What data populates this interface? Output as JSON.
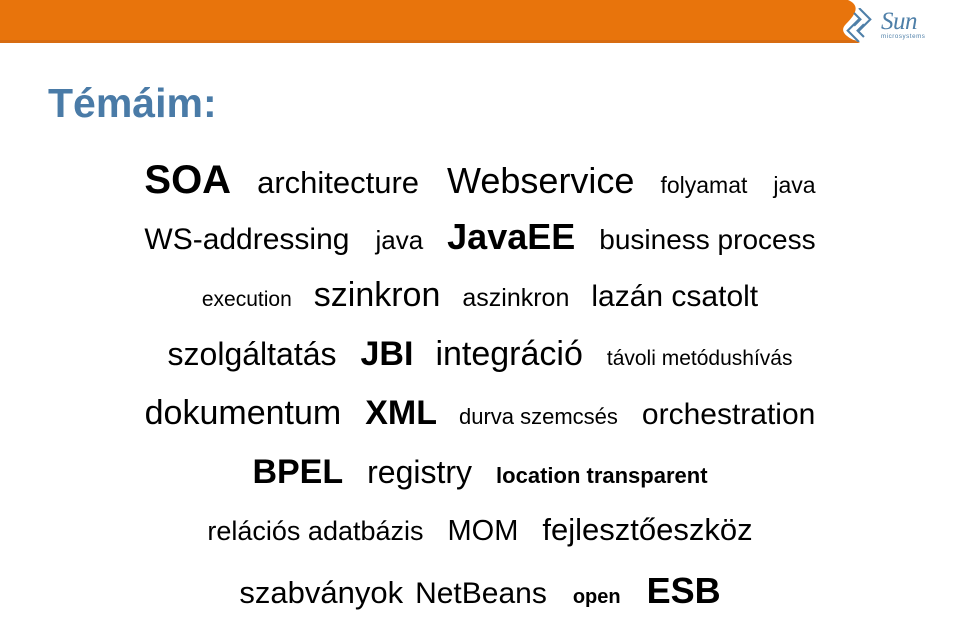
{
  "header": {
    "band_color": "#e8740c",
    "band_edge_color": "#d16a14",
    "logo": {
      "mark_name": "sun-diamond-logo-icon",
      "wordmark": "Sun",
      "tagline": "microsystems",
      "color": "#4e7fa8"
    }
  },
  "slide": {
    "title": "Témáim:",
    "title_color": "#4a7ba7",
    "background": "#ffffff"
  },
  "word_cloud": {
    "text_color": "#000000",
    "rows": [
      {
        "words": [
          {
            "text": "SOA",
            "size": 40,
            "weight": "bold",
            "gap_after": 26
          },
          {
            "text": "architecture",
            "size": 31,
            "weight": "normal",
            "gap_after": 28
          },
          {
            "text": "Webservice",
            "size": 36,
            "weight": "normal",
            "gap_after": 26
          },
          {
            "text": "folyamat",
            "size": 23,
            "weight": "normal",
            "gap_after": 26
          },
          {
            "text": "java",
            "size": 23,
            "weight": "normal",
            "gap_after": 0
          }
        ]
      },
      {
        "words": [
          {
            "text": "WS-addressing",
            "size": 30,
            "weight": "normal",
            "gap_after": 26
          },
          {
            "text": "java",
            "size": 26,
            "weight": "normal",
            "gap_after": 24
          },
          {
            "text": "JavaEE",
            "size": 36,
            "weight": "bold",
            "gap_after": 24
          },
          {
            "text": "business process",
            "size": 28,
            "weight": "normal",
            "gap_after": 0
          }
        ]
      },
      {
        "words": [
          {
            "text": "execution",
            "size": 21,
            "weight": "normal",
            "gap_after": 22
          },
          {
            "text": "szinkron",
            "size": 34,
            "weight": "normal",
            "gap_after": 22
          },
          {
            "text": "aszinkron",
            "size": 25,
            "weight": "normal",
            "gap_after": 22
          },
          {
            "text": "lazán csatolt",
            "size": 30,
            "weight": "normal",
            "gap_after": 0
          }
        ]
      },
      {
        "words": [
          {
            "text": "szolgáltatás",
            "size": 32,
            "weight": "normal",
            "gap_after": 24
          },
          {
            "text": "JBI",
            "size": 34,
            "weight": "bold",
            "gap_after": 22
          },
          {
            "text": "integráció",
            "size": 34,
            "weight": "normal",
            "gap_after": 24
          },
          {
            "text": "távoli metódushívás",
            "size": 21,
            "weight": "normal",
            "gap_after": 0
          }
        ]
      },
      {
        "words": [
          {
            "text": "dokumentum",
            "size": 34,
            "weight": "normal",
            "gap_after": 24
          },
          {
            "text": "XML",
            "size": 34,
            "weight": "bold",
            "gap_after": 22
          },
          {
            "text": "durva szemcsés",
            "size": 22,
            "weight": "normal",
            "gap_after": 24
          },
          {
            "text": "orchestration",
            "size": 30,
            "weight": "normal",
            "gap_after": 0
          }
        ]
      },
      {
        "words": [
          {
            "text": "BPEL",
            "size": 34,
            "weight": "bold",
            "gap_after": 24
          },
          {
            "text": "registry",
            "size": 32,
            "weight": "normal",
            "gap_after": 24
          },
          {
            "text": "location transparent",
            "size": 22,
            "weight": "bold",
            "gap_after": 0
          }
        ]
      },
      {
        "words": [
          {
            "text": "relációs adatbázis",
            "size": 27,
            "weight": "normal",
            "gap_after": 24
          },
          {
            "text": "MOM",
            "size": 29,
            "weight": "normal",
            "gap_after": 24
          },
          {
            "text": "fejlesztőeszköz",
            "size": 31,
            "weight": "normal",
            "gap_after": 0
          }
        ]
      },
      {
        "words": [
          {
            "text": "szabványok",
            "size": 31,
            "weight": "normal",
            "gap_after": 12
          },
          {
            "text": "NetBeans",
            "size": 30,
            "weight": "normal",
            "gap_after": 26
          },
          {
            "text": "open",
            "size": 20,
            "weight": "bold",
            "gap_after": 26
          },
          {
            "text": "ESB",
            "size": 36,
            "weight": "bold",
            "gap_after": 0
          }
        ]
      }
    ]
  }
}
